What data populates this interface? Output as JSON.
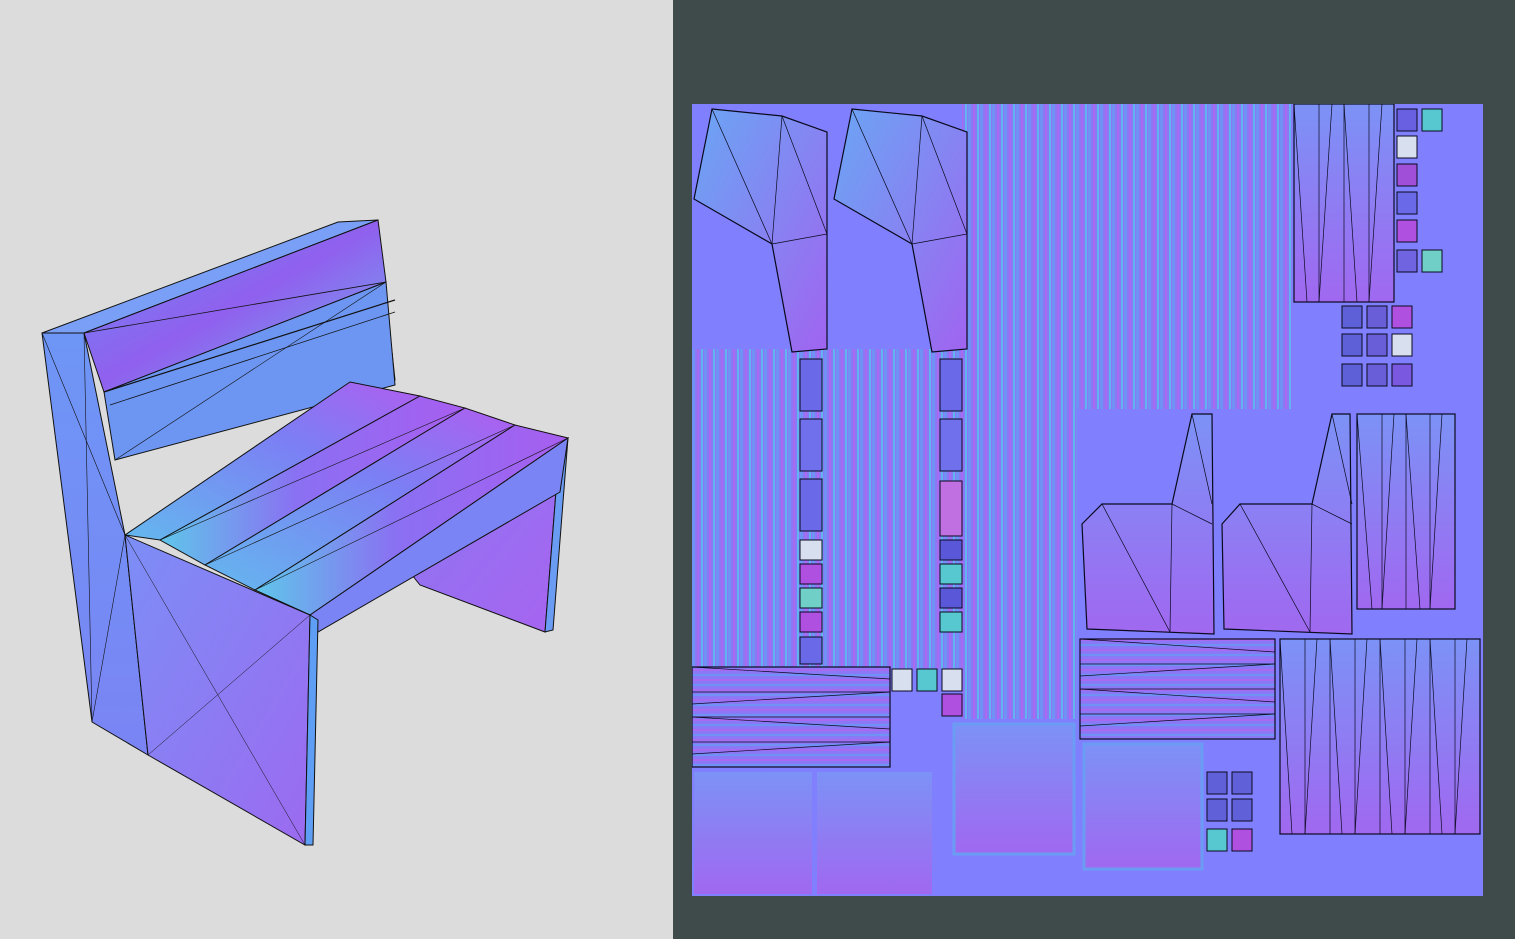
{
  "app": {
    "panels": [
      "3d-viewport",
      "uv-editor"
    ]
  },
  "colors": {
    "viewport_bg": "#dcdcdc",
    "uv_panel_bg": "#3f4a4b",
    "normal_flat": "#8080fe",
    "normal_violet": "#9a6cf0",
    "normal_blue": "#6c8cf2",
    "normal_cyan": "#5ec8e8",
    "wire": "#0a0a1e"
  },
  "model": {
    "icon": "park-bench-icon",
    "parts": [
      "backrest",
      "seat-slats",
      "left-side-panel",
      "right-side-panel"
    ]
  },
  "uv_map": {
    "icon": "normal-map-icon"
  }
}
